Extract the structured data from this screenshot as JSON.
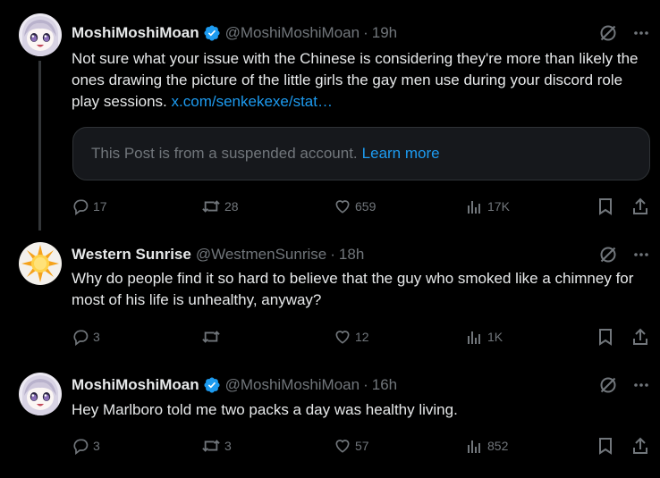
{
  "tweets": [
    {
      "author": "MoshiMoshiMoan",
      "handle": "@MoshiMoshiMoan",
      "separator": "·",
      "time": "19h",
      "verified": true,
      "text": "Not sure what your issue with the Chinese is considering they're more than likely the ones drawing the picture of the little girls the gay men use during your discord role play sessions.",
      "link": "x.com/senkekexe/stat…",
      "quote": {
        "text": "This Post is from a suspended account.",
        "link": "Learn more"
      },
      "replies": "17",
      "reposts": "28",
      "likes": "659",
      "views": "17K"
    },
    {
      "author": "Western Sunrise",
      "handle": "@WestmenSunrise",
      "separator": "·",
      "time": "18h",
      "verified": false,
      "text": "Why do people find it so hard to believe that the guy who smoked like a chimney for most of his life is unhealthy, anyway?",
      "replies": "3",
      "reposts": "",
      "likes": "12",
      "views": "1K"
    },
    {
      "author": "MoshiMoshiMoan",
      "handle": "@MoshiMoshiMoan",
      "separator": "·",
      "time": "16h",
      "verified": true,
      "text": "Hey Marlboro told me two packs a day was healthy living.",
      "replies": "3",
      "reposts": "3",
      "likes": "57",
      "views": "852"
    }
  ],
  "icons": {
    "more": "more-icon",
    "grok": "grok-icon",
    "reply": "reply-icon",
    "repost": "repost-icon",
    "like": "like-icon",
    "views": "views-icon",
    "bookmark": "bookmark-icon",
    "share": "share-icon"
  },
  "colors": {
    "background": "#000000",
    "text": "#e7e9ea",
    "muted": "#71767b",
    "link": "#1d9bf0",
    "verified": "#1d9bf0"
  }
}
